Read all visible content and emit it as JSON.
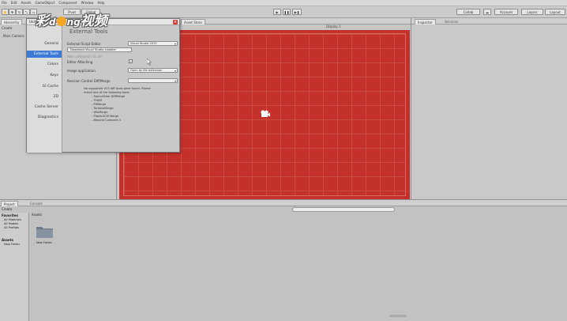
{
  "menubar": {
    "items": [
      "File",
      "Edit",
      "Assets",
      "GameObject",
      "Component",
      "Window",
      "Help"
    ]
  },
  "toolbar": {
    "pivot": "Pivot",
    "global": "Global",
    "collab": "Collab",
    "account": "Account",
    "layers": "Layers",
    "layout": "Layout"
  },
  "hierarchy": {
    "tab": "Hierarchy",
    "create": "Create",
    "item": "Main Camera"
  },
  "scene_tabs": {
    "asset_store": "Asset Store",
    "display": "Display 1"
  },
  "inspector": {
    "tab": "Inspector",
    "services": "Services"
  },
  "dialog": {
    "title": "Unity Preferences",
    "sidebar": [
      {
        "label": "General",
        "selected": false
      },
      {
        "label": "External Tools",
        "selected": true
      },
      {
        "label": "Colors",
        "selected": false
      },
      {
        "label": "Keys",
        "selected": false
      },
      {
        "label": "GI Cache",
        "selected": false
      },
      {
        "label": "2D",
        "selected": false
      },
      {
        "label": "Cache Server",
        "selected": false
      },
      {
        "label": "Diagnostics",
        "selected": false
      }
    ],
    "heading": "External Tools",
    "script_editor_label": "External Script Editor",
    "script_editor_value": "Visual Studio 2015",
    "download_button": "Download Visual Studio Installer",
    "add_unity_project": "Add .unityproj's to .sln",
    "editor_attaching": "Editor Attaching",
    "editor_attaching_checked": true,
    "image_app_label": "Image application",
    "image_app_value": "Open by file extension",
    "revision_label": "Revision Control Diff/Merge",
    "revision_value": "",
    "note_lines": [
      "No supported VCS diff tools were found. Please",
      "install one of the following tools:",
      "- SourceGear DiffMerge",
      "- TkDiff",
      "- P4Merge",
      "- TortoiseMerge",
      "- WinMerge",
      "- PlasticSCM Merge",
      "- Beyond Compare 4"
    ]
  },
  "project": {
    "tab_project": "Project",
    "tab_console": "Console",
    "create": "Create",
    "favorites": "Favorites",
    "fav_items": [
      "All Materials",
      "All Models",
      "All Prefabs"
    ],
    "assets_header": "Assets",
    "assets_tree": [
      "Assets",
      "New Folder"
    ],
    "breadcrumb": "Assets",
    "folder_name": "New Folder"
  },
  "watermark": "彩dong视频",
  "colors": {
    "game_view": "#c4312a",
    "selection": "#3d7ad6"
  }
}
